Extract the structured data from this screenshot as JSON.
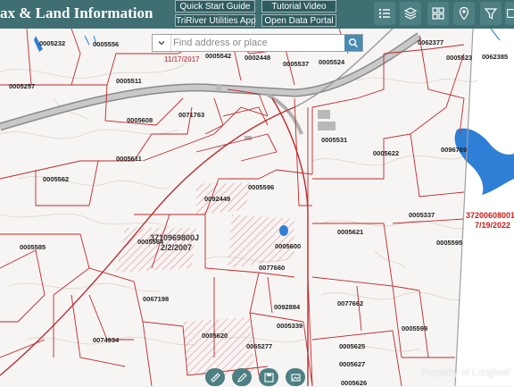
{
  "header": {
    "title": "ax & Land Information",
    "buttons": {
      "quick_start": "Quick Start Guide",
      "tutorial": "Tutorial Video",
      "utilities": "TriRiver Utilities App",
      "open_data": "Open Data Portal"
    },
    "icons": [
      "list-icon",
      "layers-icon",
      "basemap-icon",
      "location-icon",
      "filter-icon",
      "more-icon"
    ]
  },
  "search": {
    "placeholder": "Find address or place",
    "value": ""
  },
  "map": {
    "colors": {
      "parcel_line": "#c0282c",
      "road": "#9a9a9a",
      "water": "#2a7fd2",
      "header": "#3f6f73",
      "contour": "#d8d0c6"
    },
    "parcels": {
      "p0005232": "0005232",
      "p0005556": "0005556",
      "p0005542": "0005542",
      "p0002448": "0002448",
      "p0005537": "0005537",
      "p0005524": "0005524",
      "p0062377": "0062377",
      "p0005523": "0005523",
      "p0062385": "0062385",
      "p0005257": "0005257",
      "p0005511": "0005511",
      "p0005608": "0005608",
      "p0071763": "0071763",
      "p0005531": "0005531",
      "p0005622": "0005622",
      "p0096769": "0096769",
      "p0005611": "0005611",
      "p0005562": "0005562",
      "p0005596": "0005596",
      "p0092449": "0092449",
      "p0005337": "0005337",
      "p0005621": "0005621",
      "p0005595": "0005595",
      "p0005564": "0005564",
      "p0005600": "0005600",
      "p0005585": "0005585",
      "p0077660": "0077660",
      "p0067198": "0067198",
      "p0077662": "0077662",
      "p0092884": "0092884",
      "p0005339": "0005339",
      "p0005599": "0005599",
      "p0005620": "0005620",
      "p0074934": "0074934",
      "p0065277": "0065277",
      "p0005625": "0005625",
      "p0005627": "0005627",
      "p0005626": "0005626"
    },
    "pin_labels": {
      "pin1": "3710969800J",
      "pin1_date": "2/2/2007",
      "pin2": "37200608001",
      "pin2_date": "7/19/2022",
      "date_top": "11/17/2017"
    }
  },
  "toolbar": {
    "icons": [
      "measure-icon",
      "draw-icon",
      "print-icon",
      "bookmark-icon"
    ]
  },
  "watermark": "Property of Longleaf"
}
